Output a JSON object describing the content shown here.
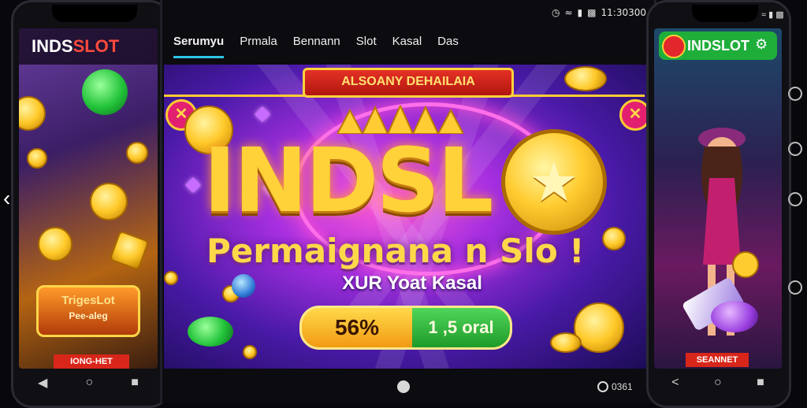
{
  "status_bar": {
    "time": "11:30300"
  },
  "nav": {
    "tabs": [
      {
        "label": "Serumyu",
        "active": true
      },
      {
        "label": "Prmala",
        "active": false
      },
      {
        "label": "Bennann",
        "active": false
      },
      {
        "label": "Slot",
        "active": false
      },
      {
        "label": "Kasal",
        "active": false
      },
      {
        "label": "Das",
        "active": false
      }
    ]
  },
  "banner": {
    "ribbon": "ALSOANY DEHAILAIA",
    "title": "INDSL",
    "subtitle": "Permaignana n Slo !",
    "tagline": "XUR Yoat Kasal",
    "promo": {
      "percent": "56%",
      "value": "1 ,5",
      "unit": "oral"
    }
  },
  "left_phone": {
    "brand_main": "INDS",
    "brand_accent": "SLOT",
    "logo_title": "TrigesLot",
    "logo_sub": "Pee-aleg",
    "cta": "IONG-HET"
  },
  "right_phone": {
    "brand": "INDSLOT",
    "cta": "SEANNET"
  },
  "bottom": {
    "counter": "0361"
  },
  "colors": {
    "accent_tab": "#2fc4e6",
    "gold": "#ffd23a",
    "brand_green": "#1fae3a",
    "cta_red": "#d8261a"
  }
}
